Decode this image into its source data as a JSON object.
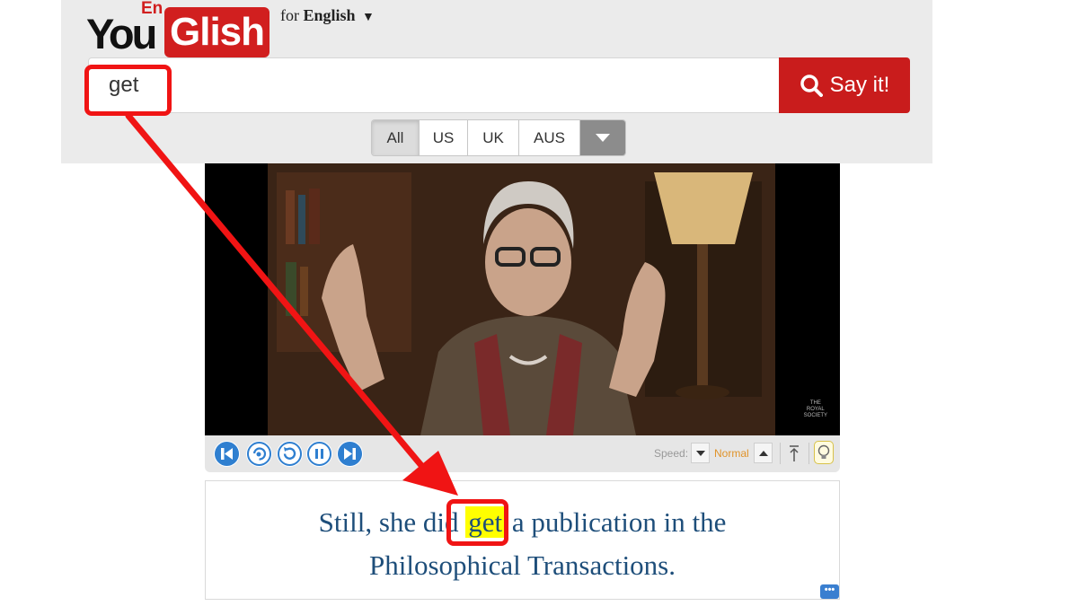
{
  "logo": {
    "you": "You",
    "en": "En",
    "glish": "Glish"
  },
  "lang_picker": {
    "prefix": "for",
    "language": "English",
    "caret": "▼"
  },
  "search": {
    "value": "get",
    "button_label": "Say it!"
  },
  "accent_filters": [
    {
      "label": "All",
      "active": true
    },
    {
      "label": "US",
      "active": false
    },
    {
      "label": "UK",
      "active": false
    },
    {
      "label": "AUS",
      "active": false
    }
  ],
  "video": {
    "watermark_line1": "THE",
    "watermark_line2": "ROYAL",
    "watermark_line3": "SOCIETY"
  },
  "controls": {
    "speed_label": "Speed:",
    "speed_value": "Normal"
  },
  "caption": {
    "before": "Still, she did ",
    "highlight": "get",
    "after": " a publication in the",
    "line2": "Philosophical Transactions."
  },
  "colors": {
    "brand_red": "#d11f1f",
    "button_red": "#c91c1c",
    "caption_blue": "#1e4e7a",
    "annotation_red": "#f01414",
    "highlight": "#ffff00",
    "speed_orange": "#e0932a"
  }
}
